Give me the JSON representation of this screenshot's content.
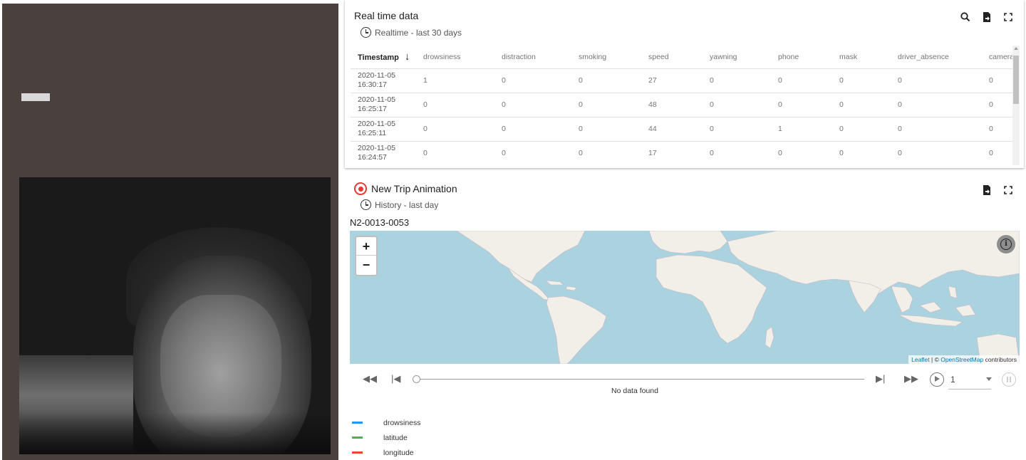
{
  "realtime": {
    "title": "Real time data",
    "subtitle": "Realtime - last 30 days",
    "columns": [
      "Timestamp",
      "drowsiness",
      "distraction",
      "smoking",
      "speed",
      "yawning",
      "phone",
      "mask",
      "driver_absence",
      "camera"
    ],
    "rows": [
      {
        "date": "2020-11-05",
        "time": "16:30:17",
        "values": [
          "1",
          "0",
          "0",
          "27",
          "0",
          "0",
          "0",
          "0",
          "0"
        ]
      },
      {
        "date": "2020-11-05",
        "time": "16:25:17",
        "values": [
          "0",
          "0",
          "0",
          "48",
          "0",
          "0",
          "0",
          "0",
          "0"
        ]
      },
      {
        "date": "2020-11-05",
        "time": "16:25:11",
        "values": [
          "0",
          "0",
          "0",
          "44",
          "0",
          "1",
          "0",
          "0",
          "0"
        ]
      },
      {
        "date": "2020-11-05",
        "time": "16:24:57",
        "values": [
          "0",
          "0",
          "0",
          "17",
          "0",
          "0",
          "0",
          "0",
          "0"
        ]
      }
    ]
  },
  "trip": {
    "title": "New Trip Animation",
    "subtitle": "History - last day",
    "device_id": "N2-0013-0053",
    "map": {
      "zoom_in": "+",
      "zoom_out": "−",
      "info": "i",
      "attribution_leaflet": "Leaflet",
      "attribution_sep": " | © ",
      "attribution_osm": "OpenStreetMap",
      "attribution_tail": " contributors"
    },
    "player": {
      "no_data": "No data found",
      "speed": "1"
    },
    "legend": [
      {
        "label": "drowsiness",
        "color": "#2196f3"
      },
      {
        "label": "latitude",
        "color": "#4caf50"
      },
      {
        "label": "longitude",
        "color": "#f44336"
      }
    ]
  },
  "icons": {
    "search": "search-icon",
    "export": "file-export-icon",
    "fullscreen": "fullscreen-icon",
    "clock": "clock-icon",
    "target": "trip-target-icon"
  }
}
